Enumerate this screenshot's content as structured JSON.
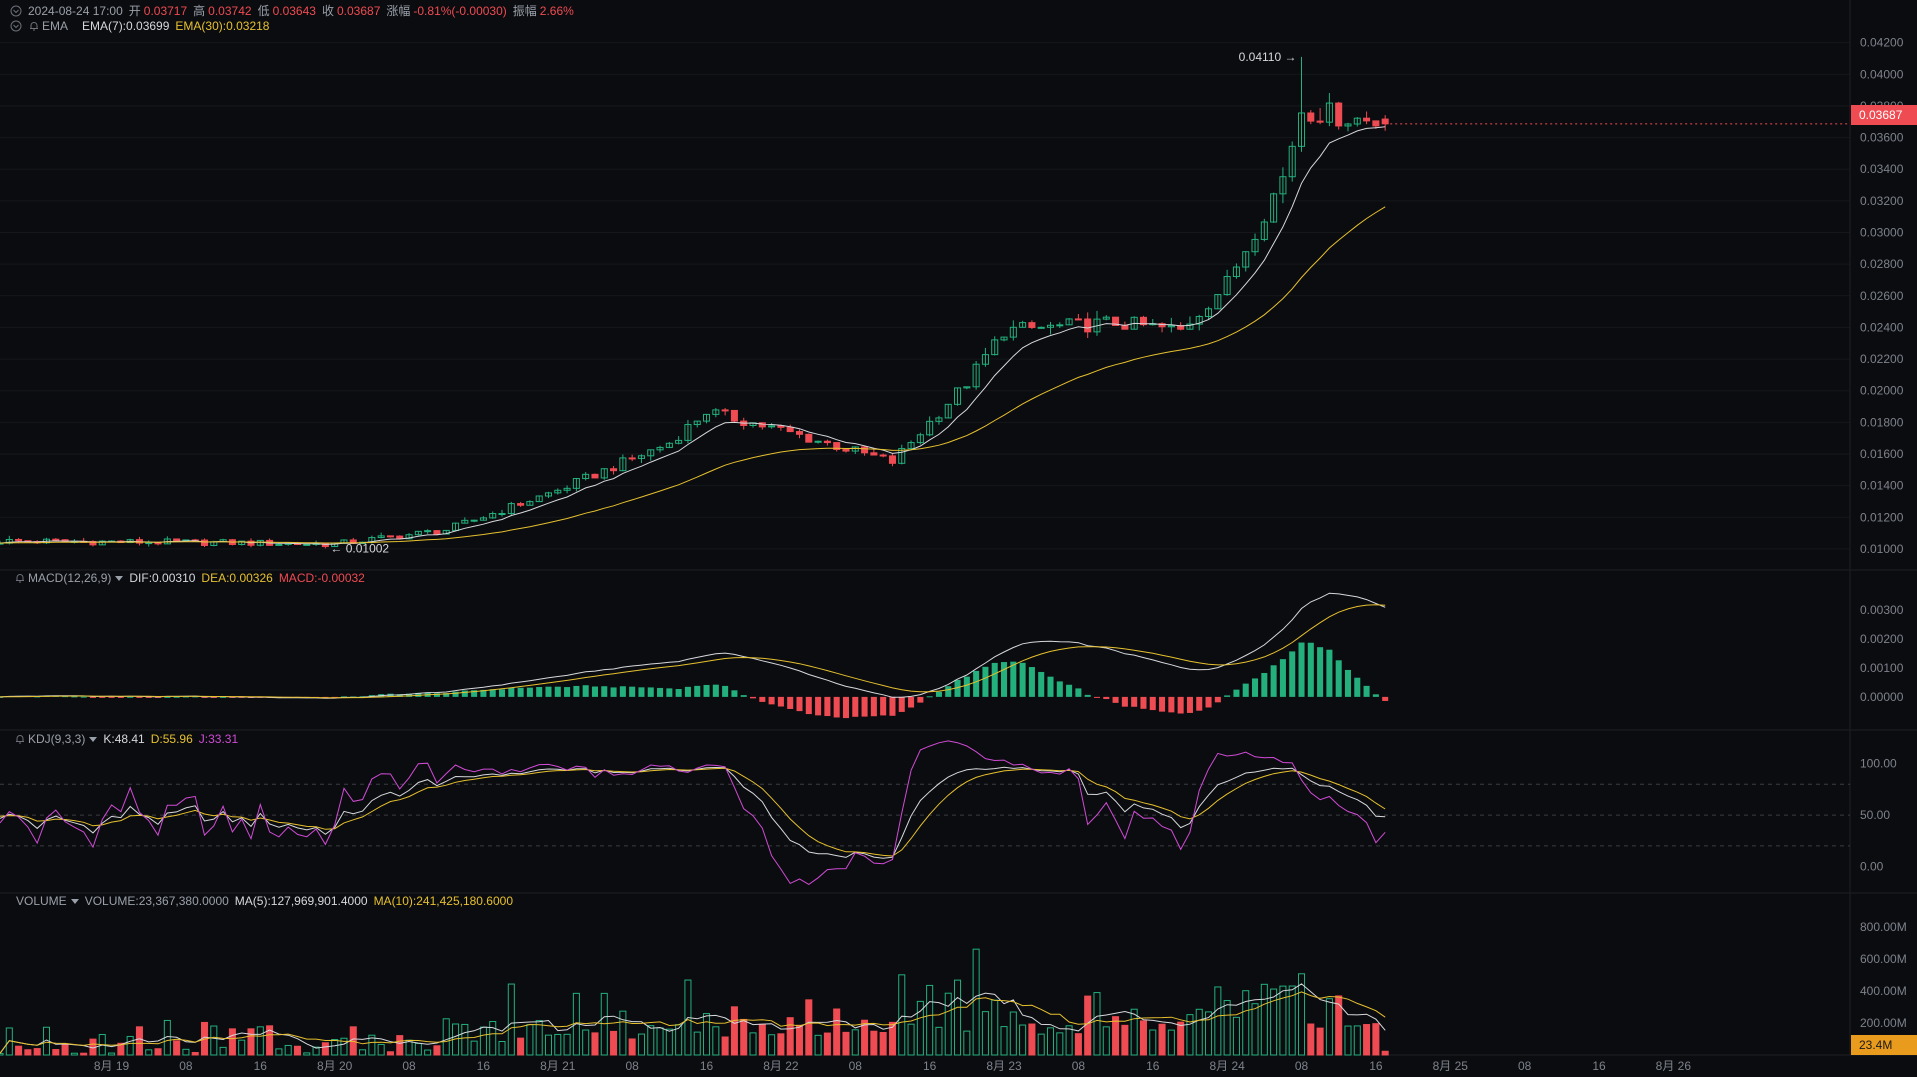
{
  "header": {
    "datetime": "2024-08-24 17:00",
    "open_label": "开",
    "open": "0.03717",
    "high_label": "高",
    "high": "0.03742",
    "low_label": "低",
    "low": "0.03643",
    "close_label": "收",
    "close": "0.03687",
    "change_label": "涨幅",
    "change": "-0.81%(-0.00030)",
    "amplitude_label": "振幅",
    "amplitude": "2.66%"
  },
  "ema_legend": {
    "name": "EMA",
    "ema7": "EMA(7):0.03699",
    "ema30": "EMA(30):0.03218"
  },
  "macd_legend": {
    "name": "MACD(12,26,9)",
    "dif": "DIF:0.00310",
    "dea": "DEA:0.00326",
    "macd": "MACD:-0.00032"
  },
  "kdj_legend": {
    "name": "KDJ(9,3,3)",
    "k": "K:48.41",
    "d": "D:55.96",
    "j": "J:33.31"
  },
  "volume_legend": {
    "name": "VOLUME",
    "volume": "VOLUME:23,367,380.0000",
    "ma5": "MA(5):127,969,901.4000",
    "ma10": "MA(10):241,425,180.6000"
  },
  "price_tag": "0.03687",
  "volume_tag": "23.4M",
  "high_marker": "0.04110",
  "low_marker": "0.01002",
  "colors": {
    "up": "#23b07d",
    "down": "#ef4b52",
    "ema7": "#d6d8dc",
    "ema30": "#e6c02f",
    "j": "#d04bd6",
    "background": "#0b0c0f",
    "volume_tag": "#e89b1c"
  },
  "chart_data": [
    {
      "type": "candlestick",
      "title": "",
      "ylim": [
        0.0093,
        0.0428
      ],
      "y_ticks": [
        "0.04200",
        "0.04000",
        "0.03800",
        "0.03600",
        "0.03400",
        "0.03200",
        "0.03000",
        "0.02800",
        "0.02600",
        "0.02400",
        "0.02200",
        "0.02000",
        "0.01800",
        "0.01600",
        "0.01400",
        "0.01200",
        "0.01000"
      ],
      "x_ticks": [
        "8月 19",
        "08",
        "16",
        "8月 20",
        "08",
        "16",
        "8月 21",
        "08",
        "16",
        "8月 22",
        "08",
        "16",
        "8月 23",
        "08",
        "16",
        "8月 24",
        "08",
        "16",
        "8月 25",
        "08",
        "16",
        "8月 26"
      ],
      "x_range_hours": [
        "2024-08-18 12:00",
        "2024-08-26 19:00"
      ],
      "interval": "1h",
      "last_candle": {
        "time": "2024-08-24 17:00",
        "open": 0.03717,
        "high": 0.03742,
        "low": 0.03643,
        "close": 0.03687
      },
      "extremes": {
        "high": 0.0411,
        "low": 0.01002
      },
      "key_closes": [
        {
          "time": "2024-08-18 12:00",
          "close": 0.0105
        },
        {
          "time": "2024-08-19 12:00",
          "close": 0.0104
        },
        {
          "time": "2024-08-20 00:00",
          "close": 0.0103
        },
        {
          "time": "2024-08-20 12:00",
          "close": 0.0112
        },
        {
          "time": "2024-08-21 00:00",
          "close": 0.0137
        },
        {
          "time": "2024-08-21 12:00",
          "close": 0.0167
        },
        {
          "time": "2024-08-21 16:00",
          "close": 0.0187
        },
        {
          "time": "2024-08-22 00:00",
          "close": 0.0175
        },
        {
          "time": "2024-08-22 12:00",
          "close": 0.0155
        },
        {
          "time": "2024-08-22 20:00",
          "close": 0.0205
        },
        {
          "time": "2024-08-23 00:00",
          "close": 0.0238
        },
        {
          "time": "2024-08-23 12:00",
          "close": 0.0243
        },
        {
          "time": "2024-08-23 19:00",
          "close": 0.0238
        },
        {
          "time": "2024-08-24 00:00",
          "close": 0.0268
        },
        {
          "time": "2024-08-24 06:00",
          "close": 0.0335
        },
        {
          "time": "2024-08-24 08:00",
          "close": 0.0378
        },
        {
          "time": "2024-08-24 17:00",
          "close": 0.03687
        }
      ],
      "series": [
        {
          "name": "EMA(7)",
          "last": 0.03699
        },
        {
          "name": "EMA(30)",
          "last": 0.03218
        }
      ]
    },
    {
      "type": "bar+line",
      "ylim": [
        -0.0008,
        0.0037
      ],
      "y_ticks": [
        "0.00300",
        "0.00200",
        "0.00100",
        "0.00000"
      ],
      "series": [
        {
          "name": "DIF",
          "last": 0.0031
        },
        {
          "name": "DEA",
          "last": 0.00326
        },
        {
          "name": "MACD",
          "last": -0.00032
        }
      ]
    },
    {
      "type": "line",
      "ylim": [
        -18,
        125
      ],
      "y_ticks": [
        "100.00",
        "50.00",
        "0.00"
      ],
      "series": [
        {
          "name": "K",
          "last": 48.41
        },
        {
          "name": "D",
          "last": 55.96
        },
        {
          "name": "J",
          "last": 33.31
        }
      ]
    },
    {
      "type": "bar",
      "ylim": [
        0,
        900000000
      ],
      "y_ticks": [
        "800.00M",
        "600.00M",
        "400.00M",
        "200.00M"
      ],
      "series": [
        {
          "name": "VOLUME",
          "last": 23367380
        },
        {
          "name": "MA(5)",
          "last": 127969901.4
        },
        {
          "name": "MA(10)",
          "last": 241425180.6
        }
      ]
    }
  ]
}
